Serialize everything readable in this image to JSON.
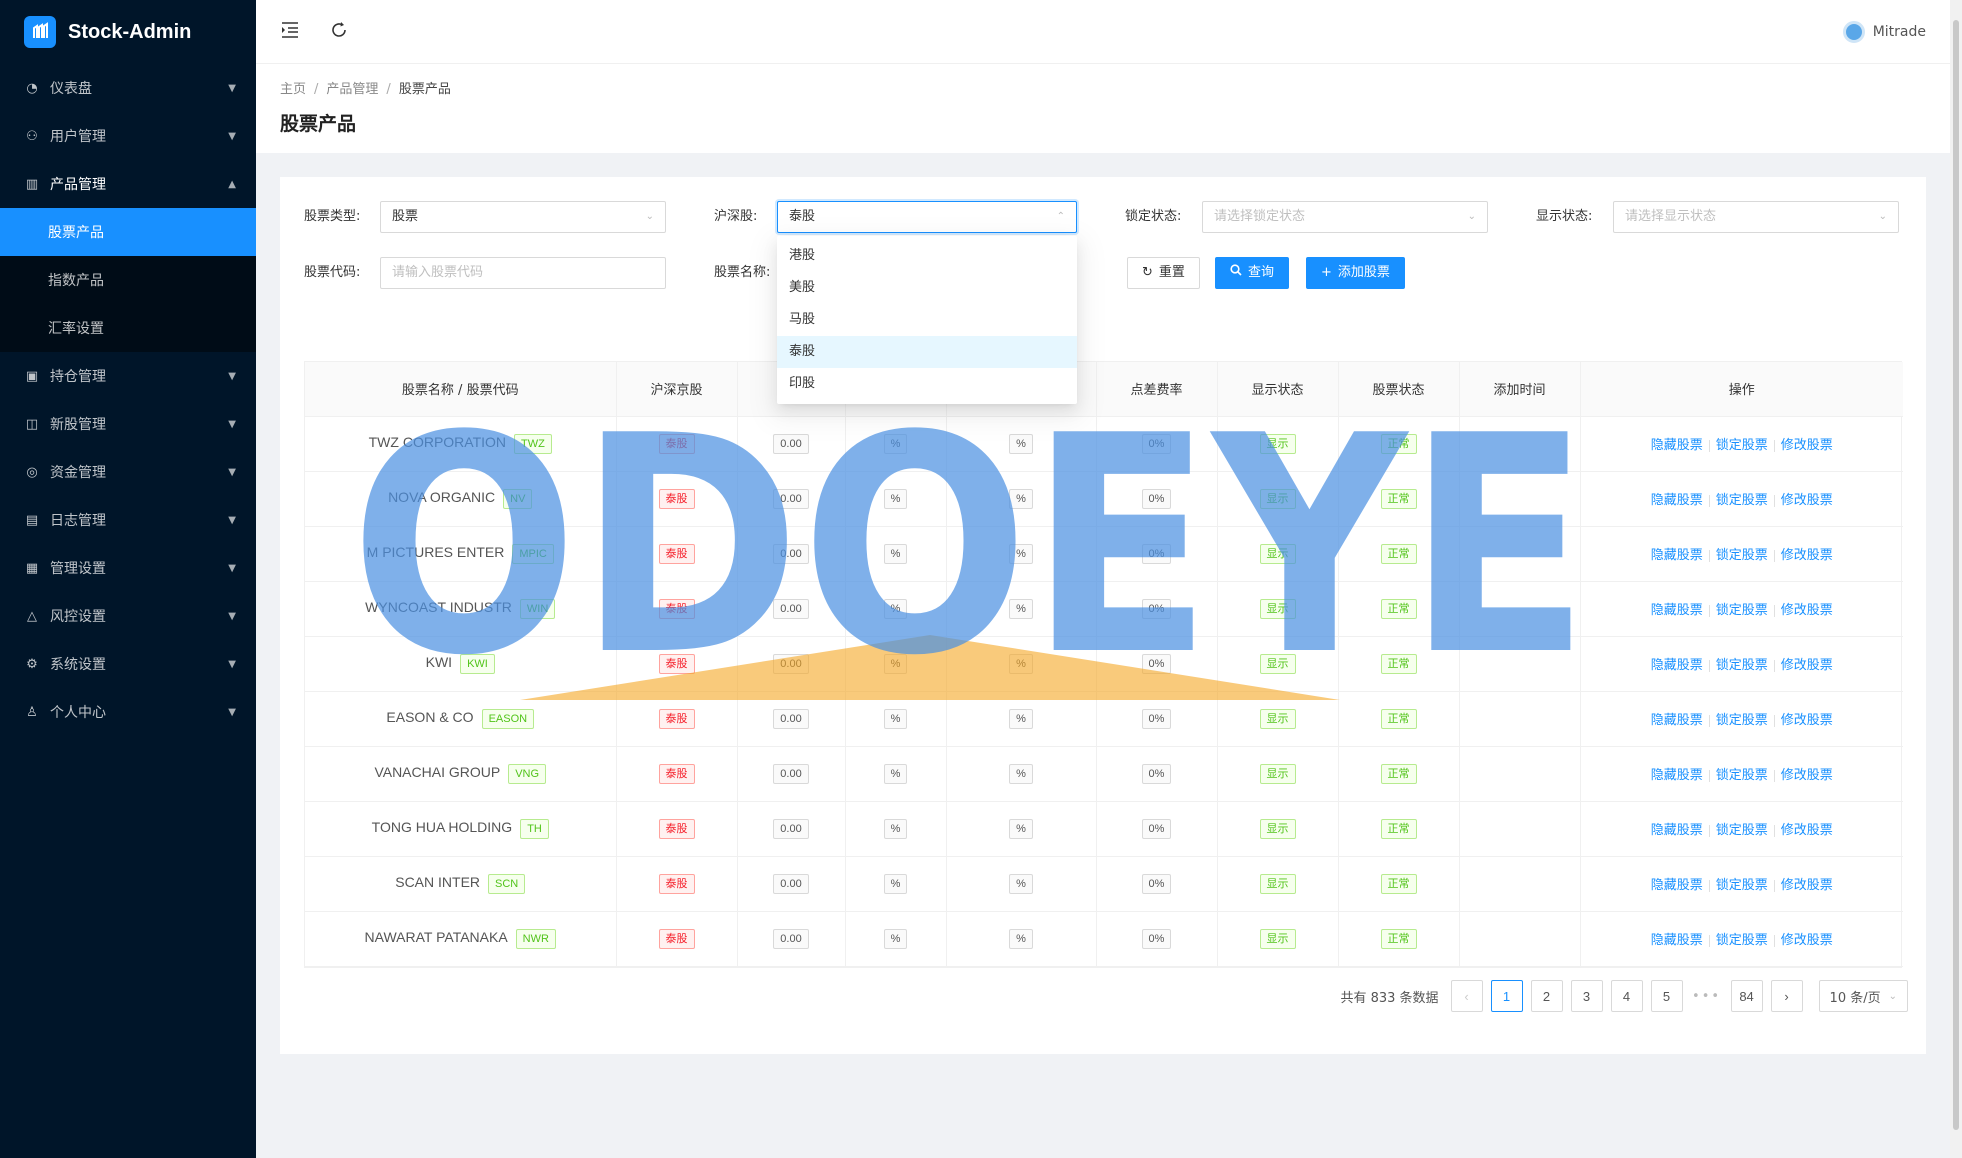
{
  "app": {
    "title": "Stock-Admin"
  },
  "sidebar": {
    "items": [
      {
        "label": "仪表盘",
        "icon": "dashboard-icon"
      },
      {
        "label": "用户管理",
        "icon": "user-group-icon"
      },
      {
        "label": "产品管理",
        "icon": "chart-icon",
        "open": true,
        "children": [
          {
            "label": "股票产品",
            "active": true
          },
          {
            "label": "指数产品"
          },
          {
            "label": "汇率设置"
          }
        ]
      },
      {
        "label": "持仓管理",
        "icon": "position-icon"
      },
      {
        "label": "新股管理",
        "icon": "ipo-icon"
      },
      {
        "label": "资金管理",
        "icon": "money-icon"
      },
      {
        "label": "日志管理",
        "icon": "log-icon"
      },
      {
        "label": "管理设置",
        "icon": "admin-settings-icon"
      },
      {
        "label": "风控设置",
        "icon": "warning-icon"
      },
      {
        "label": "系统设置",
        "icon": "gear-icon"
      },
      {
        "label": "个人中心",
        "icon": "person-icon"
      }
    ]
  },
  "header": {
    "user": "Mitrade"
  },
  "breadcrumb": [
    "主页",
    "产品管理",
    "股票产品"
  ],
  "page": {
    "title": "股票产品"
  },
  "filters": {
    "stock_type_label": "股票类型:",
    "stock_type_value": "股票",
    "market_label": "沪深股:",
    "market_value": "泰股",
    "lock_label": "锁定状态:",
    "lock_placeholder": "请选择锁定状态",
    "display_label": "显示状态:",
    "display_placeholder": "请选择显示状态",
    "code_label": "股票代码:",
    "code_placeholder": "请输入股票代码",
    "name_label": "股票名称:"
  },
  "buttons": {
    "reset": "重置",
    "query": "查询",
    "add": "添加股票"
  },
  "dropdown": {
    "options": [
      "港股",
      "美股",
      "马股",
      "泰股",
      "印股"
    ],
    "selected": "泰股"
  },
  "table": {
    "headers": [
      "股票名称 / 股票代码",
      "沪深京股",
      "",
      "",
      "",
      "点差费率",
      "显示状态",
      "股票状态",
      "添加时间",
      "操作"
    ],
    "rows": [
      {
        "name": "TWZ CORPORATION",
        "code": "TWZ",
        "market": "泰股",
        "v1": "0.00",
        "v2": "%",
        "v3": "%",
        "spread": "0%",
        "display": "显示",
        "status": "正常",
        "time": ""
      },
      {
        "name": "NOVA ORGANIC",
        "code": "NV",
        "market": "泰股",
        "v1": "0.00",
        "v2": "%",
        "v3": "%",
        "spread": "0%",
        "display": "显示",
        "status": "正常",
        "time": ""
      },
      {
        "name": "M PICTURES ENTER",
        "code": "MPIC",
        "market": "泰股",
        "v1": "0.00",
        "v2": "%",
        "v3": "%",
        "spread": "0%",
        "display": "显示",
        "status": "正常",
        "time": ""
      },
      {
        "name": "WYNCOAST INDUSTR",
        "code": "WIN",
        "market": "泰股",
        "v1": "0.00",
        "v2": "%",
        "v3": "%",
        "spread": "0%",
        "display": "显示",
        "status": "正常",
        "time": ""
      },
      {
        "name": "KWI",
        "code": "KWI",
        "market": "泰股",
        "v1": "0.00",
        "v2": "%",
        "v3": "%",
        "spread": "0%",
        "display": "显示",
        "status": "正常",
        "time": ""
      },
      {
        "name": "EASON & CO",
        "code": "EASON",
        "market": "泰股",
        "v1": "0.00",
        "v2": "%",
        "v3": "%",
        "spread": "0%",
        "display": "显示",
        "status": "正常",
        "time": ""
      },
      {
        "name": "VANACHAI GROUP",
        "code": "VNG",
        "market": "泰股",
        "v1": "0.00",
        "v2": "%",
        "v3": "%",
        "spread": "0%",
        "display": "显示",
        "status": "正常",
        "time": ""
      },
      {
        "name": "TONG HUA HOLDING",
        "code": "TH",
        "market": "泰股",
        "v1": "0.00",
        "v2": "%",
        "v3": "%",
        "spread": "0%",
        "display": "显示",
        "status": "正常",
        "time": ""
      },
      {
        "name": "SCAN INTER",
        "code": "SCN",
        "market": "泰股",
        "v1": "0.00",
        "v2": "%",
        "v3": "%",
        "spread": "0%",
        "display": "显示",
        "status": "正常",
        "time": ""
      },
      {
        "name": "NAWARAT PATANAKA",
        "code": "NWR",
        "market": "泰股",
        "v1": "0.00",
        "v2": "%",
        "v3": "%",
        "spread": "0%",
        "display": "显示",
        "status": "正常",
        "time": ""
      }
    ],
    "actions": [
      "隐藏股票",
      "锁定股票",
      "修改股票"
    ]
  },
  "pagination": {
    "total_text": "共有 833 条数据",
    "pages": [
      "1",
      "2",
      "3",
      "4",
      "5"
    ],
    "last_page": "84",
    "current": "1",
    "page_size": "10 条/页"
  },
  "watermark": {
    "text": "ODOEYE"
  },
  "colors": {
    "primary": "#1890ff",
    "sidebar": "#001529",
    "watermark_blue": "#4a90e2",
    "watermark_orange": "#f5a623"
  }
}
